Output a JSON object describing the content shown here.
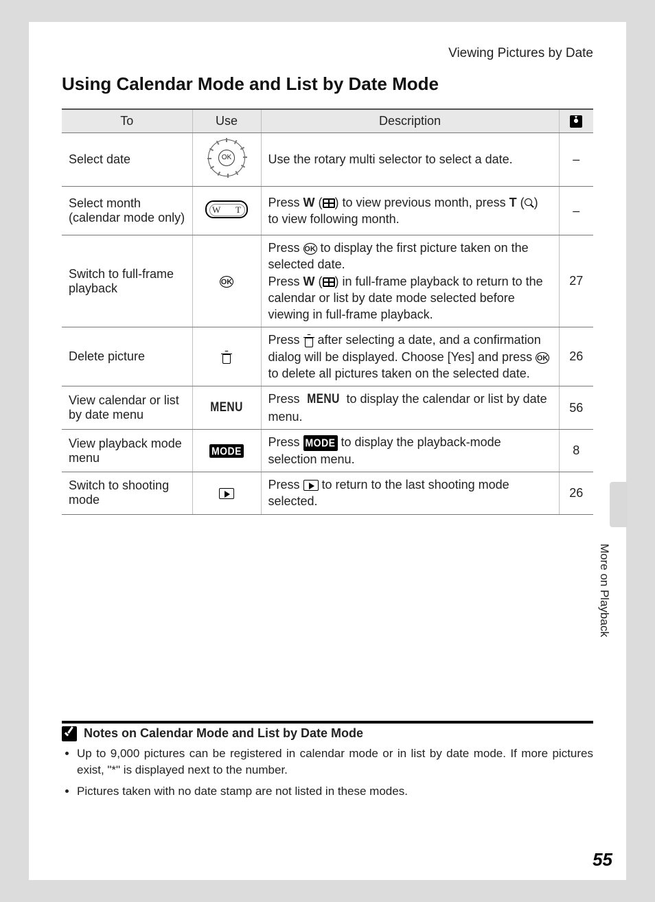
{
  "breadcrumb": "Viewing Pictures by Date",
  "heading": "Using Calendar Mode and List by Date Mode",
  "table_head": {
    "to": "To",
    "use": "Use",
    "desc": "Description"
  },
  "rows": [
    {
      "to": "Select date",
      "desc_pre": "Use the rotary multi selector to select a date.",
      "ref": "–"
    },
    {
      "to": "Select month (calendar mode only)",
      "desc_a": "Press ",
      "desc_b": " (",
      "desc_c": ") to view previous month, press ",
      "desc_d": " (",
      "desc_e": ") to view following month.",
      "ref": "–"
    },
    {
      "to": "Switch to full-frame playback",
      "d1": "Press ",
      "d2": " to display the first picture taken on the selected date.",
      "d3": "Press ",
      "d4": " (",
      "d5": ") in full-frame playback to return to the calendar or list by date mode selected before viewing in full-frame playback.",
      "ref": "27"
    },
    {
      "to": "Delete picture",
      "d1": "Press ",
      "d2": " after selecting a date, and a confirmation dialog will be displayed. Choose [Yes] and press ",
      "d3": " to delete all pictures taken on the selected date.",
      "ref": "26"
    },
    {
      "to": "View calendar or list by date menu",
      "d1": "Press ",
      "d2": " to display the calendar or list by date menu.",
      "ref": "56"
    },
    {
      "to": "View playback mode menu",
      "d1": "Press ",
      "d2": " to display the playback-mode selection menu.",
      "ref": "8"
    },
    {
      "to": "Switch to shooting mode",
      "d1": "Press ",
      "d2": " to return to the last shooting mode selected.",
      "ref": "26"
    }
  ],
  "notes_title": "Notes on Calendar Mode and List by Date Mode",
  "notes": [
    "Up to 9,000 pictures can be registered in calendar mode or in list by date mode. If more pictures exist, \"*\" is displayed next to the number.",
    "Pictures taken with no date stamp are not listed in these modes."
  ],
  "side_label": "More on Playback",
  "page_number": "55",
  "labels": {
    "W": "W",
    "T": "T",
    "OK": "OK",
    "MENU": "MENU",
    "MODE": "MODE"
  }
}
